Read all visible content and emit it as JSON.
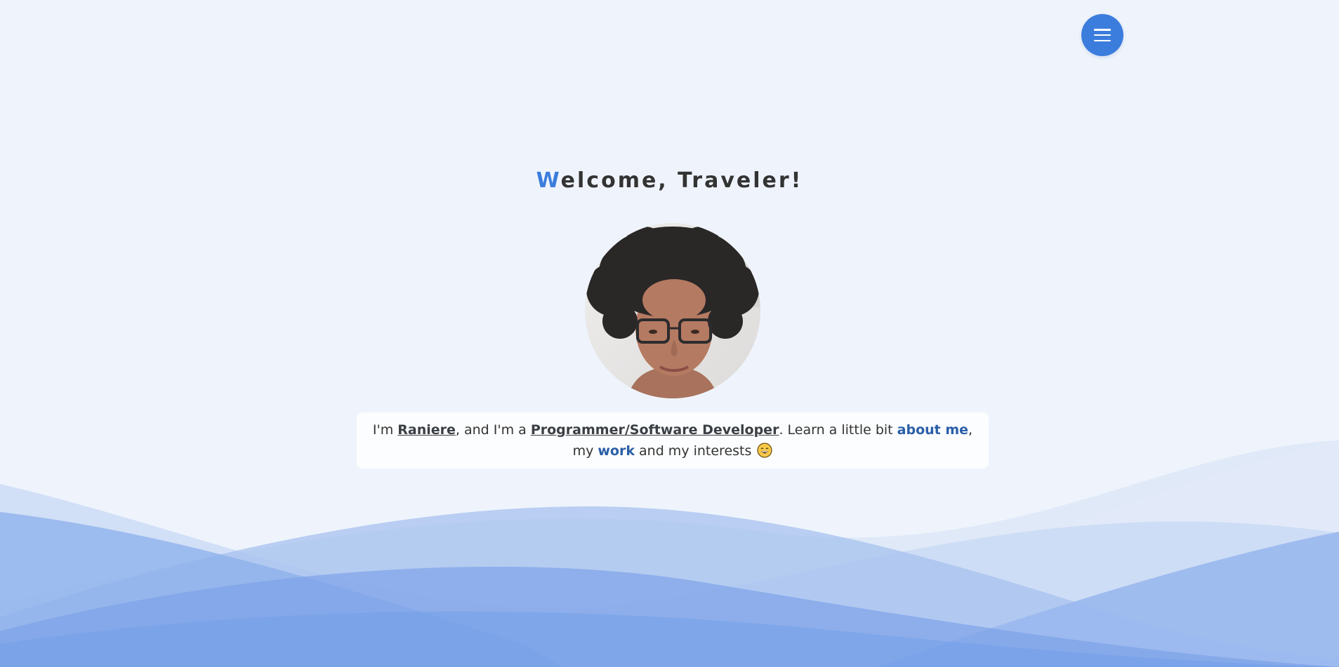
{
  "header": {
    "menu_icon": "hamburger-menu-icon",
    "accent_color": "#3b7ddd"
  },
  "hero": {
    "title_first_letter": "W",
    "title_rest": "elcome, Traveler!",
    "avatar_alt": "Raniere"
  },
  "intro": {
    "t1": "I'm ",
    "name": "Raniere",
    "t2": ", and I'm a ",
    "role": "Programmer/Software Developer",
    "t3": ". Learn a little bit ",
    "about_link": "about me",
    "t4": ", my ",
    "work_link": "work",
    "t5": " and my interests ",
    "emoji_icon": "grinning-face-icon"
  },
  "colors": {
    "background": "#eff4fc",
    "accent": "#3b7ddd",
    "link": "#2a5ea8",
    "text": "#333333",
    "card": "#fcfdfe"
  }
}
